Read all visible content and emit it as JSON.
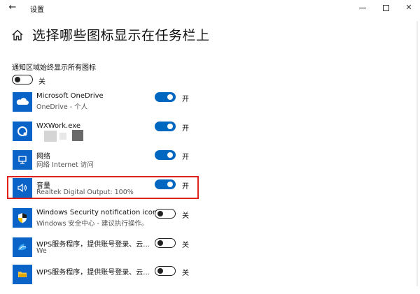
{
  "window": {
    "title": "设置",
    "back_glyph": "←",
    "close_glyph": "✕"
  },
  "header": {
    "title": "选择哪些图标显示在任务栏上"
  },
  "always_show": {
    "label": "通知区域始终显示所有图标",
    "state": "关",
    "on": false
  },
  "apps": [
    {
      "name": "Microsoft OneDrive",
      "subtitle": "OneDrive - 个人",
      "state": "开",
      "on": true,
      "icon": "onedrive-cloud-icon"
    },
    {
      "name": "WXWork.exe",
      "subtitle": "",
      "state": "开",
      "on": true,
      "icon": "wxwork-icon"
    },
    {
      "name": "网络",
      "subtitle": "网络 Internet 访问",
      "state": "开",
      "on": true,
      "icon": "network-monitor-icon"
    },
    {
      "name": "音量",
      "subtitle": "Realtek Digital Output: 100%",
      "state": "开",
      "on": true,
      "icon": "speaker-volume-icon"
    },
    {
      "name": "Windows Security notification icon",
      "subtitle": "Windows 安全中心 - 建议执行操作。",
      "state": "关",
      "on": false,
      "icon": "shield-warning-icon"
    },
    {
      "name": "WPS服务程序，提供账号登录、云...",
      "subtitle": "We",
      "state": "关",
      "on": false,
      "icon": "wps-cloud-icon"
    },
    {
      "name": "WPS服务程序，提供账号登录、云...",
      "subtitle": "",
      "state": "关",
      "on": false,
      "icon": "wps-folder-icon"
    }
  ],
  "colors": {
    "accent": "#0067c0",
    "icon_tile": "#0a64c8",
    "highlight_border": "#e0221b"
  }
}
